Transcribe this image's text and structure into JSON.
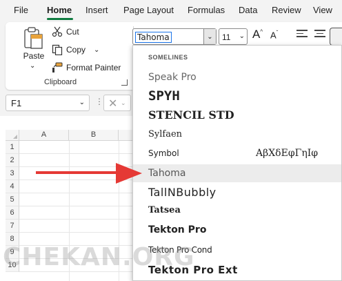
{
  "menu": {
    "tabs": [
      {
        "label": "File"
      },
      {
        "label": "Home"
      },
      {
        "label": "Insert"
      },
      {
        "label": "Page Layout"
      },
      {
        "label": "Formulas"
      },
      {
        "label": "Data"
      },
      {
        "label": "Review"
      },
      {
        "label": "View"
      }
    ],
    "active_tab": "Home"
  },
  "ribbon": {
    "clipboard": {
      "paste_label": "Paste",
      "cut_label": "Cut",
      "copy_label": "Copy",
      "format_painter_label": "Format Painter",
      "group_label": "Clipboard"
    },
    "font": {
      "current_font": "Tahoma",
      "current_size": "11"
    }
  },
  "formula_bar": {
    "name_box": "F1"
  },
  "grid": {
    "columns": [
      "A",
      "B"
    ],
    "rows": [
      "1",
      "2",
      "3",
      "4",
      "5",
      "6",
      "7",
      "8",
      "9",
      "10"
    ]
  },
  "font_list": {
    "items": [
      {
        "name": "SOMELINES",
        "preview": ""
      },
      {
        "name": "Speak Pro",
        "preview": ""
      },
      {
        "name": "SPYH",
        "preview": ""
      },
      {
        "name": "STENCIL STD",
        "preview": ""
      },
      {
        "name": "Sylfaen",
        "preview": ""
      },
      {
        "name": "Symbol",
        "preview": "ΑβΧδΕφΓηΙφ"
      },
      {
        "name": "Tahoma",
        "preview": ""
      },
      {
        "name": "TallNBubbly",
        "preview": ""
      },
      {
        "name": "Tatsea",
        "preview": ""
      },
      {
        "name": "Tekton Pro",
        "preview": ""
      },
      {
        "name": "Tekton Pro Cond",
        "preview": ""
      },
      {
        "name": "Tekton Pro Ext",
        "preview": ""
      }
    ],
    "hovered": "Tahoma"
  },
  "annotation": {
    "arrow_color": "#e53935"
  },
  "watermark": "CHEKAN.ORG",
  "colors": {
    "accent": "#107c41",
    "ribbon_bg": "#f3f3f3",
    "arrow": "#e53935"
  },
  "icons": [
    "paste-icon",
    "cut-icon",
    "copy-icon",
    "format-painter-icon",
    "chevron-down-icon",
    "grow-font-icon",
    "shrink-font-icon",
    "align-icon",
    "cancel-icon"
  ]
}
